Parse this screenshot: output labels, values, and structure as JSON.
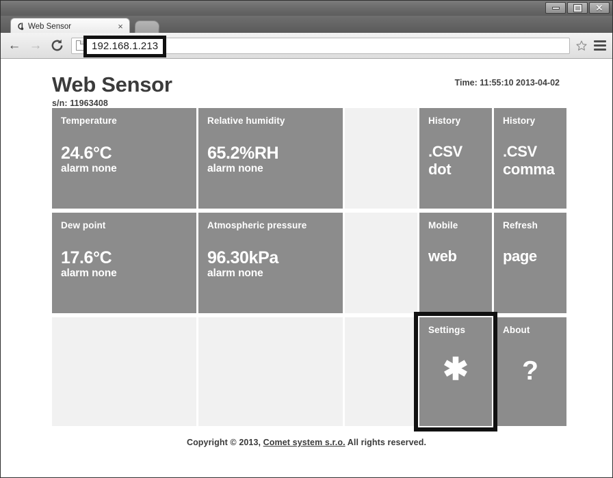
{
  "window": {
    "controls": [
      {
        "name": "minimize",
        "glyph": "minimize-icon"
      },
      {
        "name": "maximize",
        "glyph": "maximize-icon"
      },
      {
        "name": "close",
        "glyph": "X"
      }
    ]
  },
  "browser": {
    "tab": {
      "title": "Web Sensor",
      "favicon": "comet-c-icon",
      "close_label": "×"
    },
    "new_tab_label": "",
    "nav": {
      "back": "←",
      "forward": "→",
      "reload": "⟳"
    },
    "omnibox": {
      "url": "192.168.1.213",
      "placeholder": ""
    },
    "bookmark_star": "☆",
    "menu": "hamburger-icon"
  },
  "page": {
    "title": "Web Sensor",
    "serial": "s/n: 11963408",
    "time": "Time: 11:55:10 2013-04-02",
    "footer": {
      "prefix": "Copyright © 2013, ",
      "link": "Comet system s.r.o.",
      "suffix": " All rights reserved."
    }
  },
  "tiles": [
    {
      "id": "temperature",
      "label": "Temperature",
      "value": "24.6°C",
      "sub": "alarm none",
      "state": "filled"
    },
    {
      "id": "relative-humidity",
      "label": "Relative humidity",
      "value": "65.2%RH",
      "sub": "alarm none",
      "state": "filled"
    },
    {
      "id": "spacer-r1",
      "label": "",
      "value": "",
      "sub": "",
      "state": "empty"
    },
    {
      "id": "history-csv-dot",
      "label": "History",
      "value": ".CSV",
      "sub": "dot",
      "state": "filled"
    },
    {
      "id": "history-csv-comma",
      "label": "History",
      "value": ".CSV",
      "sub": "comma",
      "state": "filled"
    },
    {
      "id": "dew-point",
      "label": "Dew point",
      "value": "17.6°C",
      "sub": "alarm none",
      "state": "filled"
    },
    {
      "id": "atmospheric-pressure",
      "label": "Atmospheric pressure",
      "value": "96.30kPa",
      "sub": "alarm none",
      "state": "filled"
    },
    {
      "id": "spacer-r2",
      "label": "",
      "value": "",
      "sub": "",
      "state": "empty"
    },
    {
      "id": "mobile-web",
      "label": "Mobile",
      "value": "web",
      "sub": "",
      "state": "filled"
    },
    {
      "id": "refresh-page",
      "label": "Refresh",
      "value": "page",
      "sub": "",
      "state": "filled"
    },
    {
      "id": "spacer-r3a",
      "label": "",
      "value": "",
      "sub": "",
      "state": "empty"
    },
    {
      "id": "spacer-r3b",
      "label": "",
      "value": "",
      "sub": "",
      "state": "empty"
    },
    {
      "id": "spacer-r3c",
      "label": "",
      "value": "",
      "sub": "",
      "state": "empty"
    },
    {
      "id": "settings",
      "label": "Settings",
      "value": "",
      "sub": "",
      "glyph": "✱",
      "glyph_name": "asterisk-icon",
      "state": "filled",
      "highlighted": true
    },
    {
      "id": "about",
      "label": "About",
      "value": "",
      "sub": "",
      "glyph": "?",
      "glyph_name": "question-mark-icon",
      "state": "filled"
    }
  ],
  "colors": {
    "tile_filled": "#8c8c8c",
    "tile_empty": "#f1f1f1",
    "page_bg": "#ffffff",
    "text_dark": "#3b3b3b",
    "highlight_border": "#111111"
  }
}
